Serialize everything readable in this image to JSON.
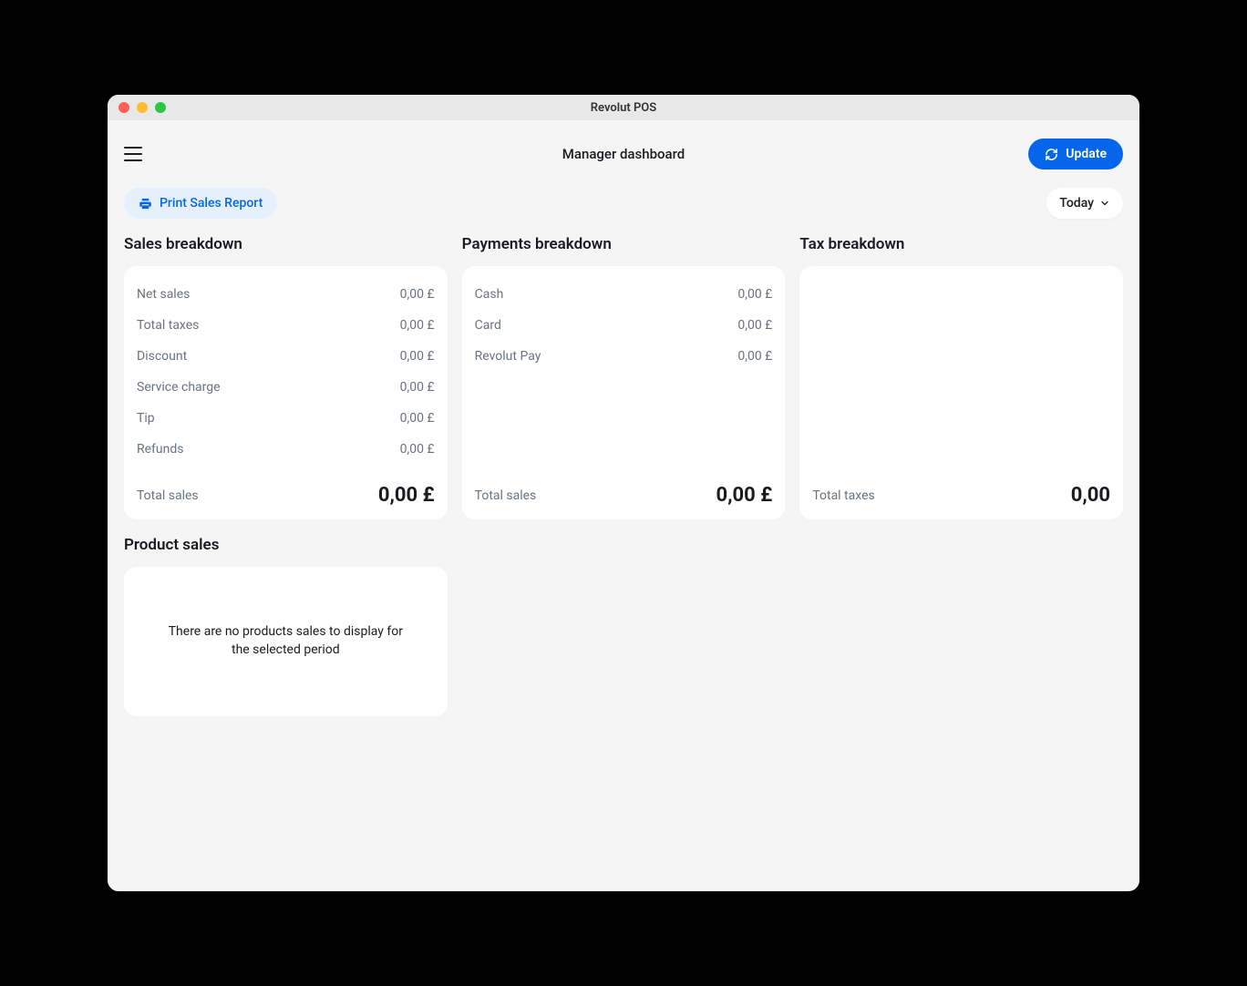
{
  "window": {
    "title": "Revolut POS"
  },
  "header": {
    "page_title": "Manager dashboard",
    "update_label": "Update"
  },
  "toolbar": {
    "print_label": "Print Sales Report",
    "date_filter_label": "Today"
  },
  "sales_breakdown": {
    "title": "Sales breakdown",
    "rows": [
      {
        "label": "Net sales",
        "value": "0,00 £"
      },
      {
        "label": "Total taxes",
        "value": "0,00 £"
      },
      {
        "label": "Discount",
        "value": "0,00 £"
      },
      {
        "label": "Service charge",
        "value": "0,00 £"
      },
      {
        "label": "Tip",
        "value": "0,00 £"
      },
      {
        "label": "Refunds",
        "value": "0,00 £"
      }
    ],
    "total_label": "Total sales",
    "total_value": "0,00 £"
  },
  "payments_breakdown": {
    "title": "Payments breakdown",
    "rows": [
      {
        "label": "Cash",
        "value": "0,00 £"
      },
      {
        "label": "Card",
        "value": "0,00 £"
      },
      {
        "label": "Revolut Pay",
        "value": "0,00 £"
      }
    ],
    "total_label": "Total sales",
    "total_value": "0,00 £"
  },
  "tax_breakdown": {
    "title": "Tax breakdown",
    "total_label": "Total taxes",
    "total_value": "0,00"
  },
  "product_sales": {
    "title": "Product sales",
    "empty_message": "There are no products sales to display for the selected period"
  }
}
